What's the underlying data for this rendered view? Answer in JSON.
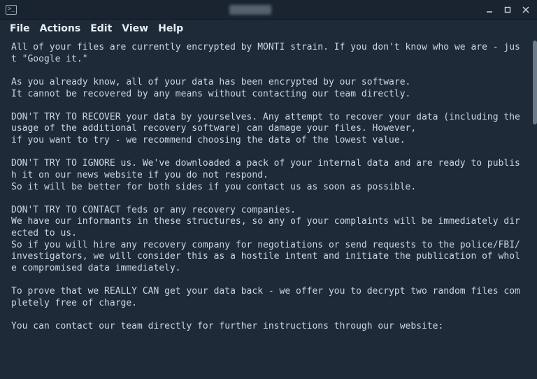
{
  "titlebar": {
    "icon_glyph": ">_"
  },
  "menu": {
    "items": [
      "File",
      "Actions",
      "Edit",
      "View",
      "Help"
    ]
  },
  "body": {
    "text": "All of your files are currently encrypted by MONTI strain. If you don't know who we are - just \"Google it.\"\n\nAs you already know, all of your data has been encrypted by our software.\nIt cannot be recovered by any means without contacting our team directly.\n\nDON'T TRY TO RECOVER your data by yourselves. Any attempt to recover your data (including the usage of the additional recovery software) can damage your files. However,\nif you want to try - we recommend choosing the data of the lowest value.\n\nDON'T TRY TO IGNORE us. We've downloaded a pack of your internal data and are ready to publish it on our news website if you do not respond.\nSo it will be better for both sides if you contact us as soon as possible.\n\nDON'T TRY TO CONTACT feds or any recovery companies.\nWe have our informants in these structures, so any of your complaints will be immediately directed to us.\nSo if you will hire any recovery company for negotiations or send requests to the police/FBI/investigators, we will consider this as a hostile intent and initiate the publication of whole compromised data immediately.\n\nTo prove that we REALLY CAN get your data back - we offer you to decrypt two random files completely free of charge.\n\nYou can contact our team directly for further instructions through our website:"
  }
}
